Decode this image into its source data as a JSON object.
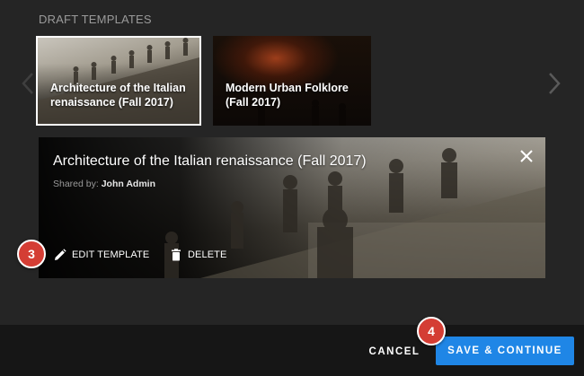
{
  "section": {
    "label": "DRAFT TEMPLATES"
  },
  "carousel": {
    "prev_icon": "chevron-left-icon",
    "next_icon": "chevron-right-icon",
    "templates": [
      {
        "title": "Architecture of the Italian renaissance (Fall 2017)",
        "selected": true
      },
      {
        "title": "Modern Urban Folklore (Fall 2017)",
        "selected": false
      }
    ]
  },
  "detail": {
    "title": "Architecture of the Italian renaissance (Fall 2017)",
    "shared_label": "Shared by:",
    "owner": "John Admin",
    "close_icon": "close-icon",
    "actions": {
      "edit": {
        "label": "EDIT TEMPLATE",
        "icon": "pencil-icon"
      },
      "delete": {
        "label": "DELETE",
        "icon": "trash-icon"
      }
    }
  },
  "steps": {
    "edit_step": "3",
    "save_step": "4"
  },
  "footer": {
    "cancel_label": "CANCEL",
    "save_label": "SAVE & CONTINUE"
  },
  "colors": {
    "background": "#252525",
    "footer": "#161616",
    "accent": "#1f86e6",
    "badge": "#d43d34"
  }
}
